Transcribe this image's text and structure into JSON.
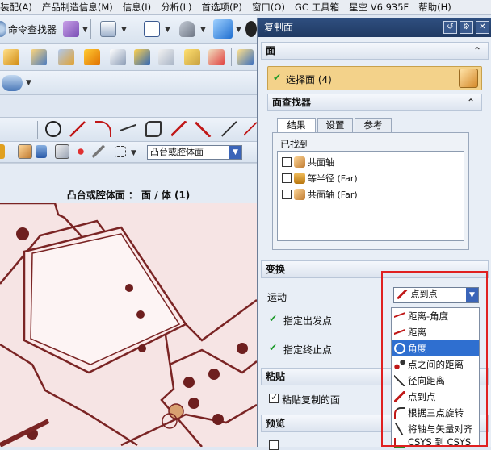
{
  "menu": {
    "items": [
      "装配(A)",
      "产品制造信息(M)",
      "信息(I)",
      "分析(L)",
      "首选项(P)",
      "窗口(O)",
      "GC 工具箱",
      "星空 V6.935F",
      "帮助(H)"
    ],
    "window_buttons": [
      "_",
      "□",
      "×"
    ]
  },
  "toolbar": {
    "command_finder_label": "命令查找器",
    "filter_combo_value": "凸台或腔体面"
  },
  "status": {
    "selection_text": "凸台或腔体面 ： 面 / 体 (1)"
  },
  "dialog": {
    "title": "复制面",
    "sections": {
      "face": {
        "header": "面",
        "select_face_label": "选择面 (4)"
      },
      "face_finder": {
        "header": "面查找器",
        "tabs": [
          "结果",
          "设置",
          "参考"
        ],
        "found_label": "已找到",
        "found_items": [
          {
            "label": "共面轴",
            "checked": false
          },
          {
            "label": "等半径 (Far)",
            "checked": false
          },
          {
            "label": "共面轴 (Far)",
            "checked": false
          }
        ]
      },
      "transform": {
        "header": "变换",
        "motion_label": "运动",
        "motion_value": "点到点",
        "from_point_label": "指定出发点",
        "to_point_label": "指定终止点"
      },
      "paste": {
        "header": "粘贴",
        "paste_copied_label": "粘贴复制的面",
        "paste_copied_checked": true
      },
      "preview": {
        "header": "预览"
      }
    },
    "motion_options": [
      {
        "label": "距离-角度",
        "selected": false
      },
      {
        "label": "距离",
        "selected": false
      },
      {
        "label": "角度",
        "selected": true
      },
      {
        "label": "点之间的距离",
        "selected": false
      },
      {
        "label": "径向距离",
        "selected": false
      },
      {
        "label": "点到点",
        "selected": false
      },
      {
        "label": "根据三点旋转",
        "selected": false
      },
      {
        "label": "将轴与矢量对齐",
        "selected": false
      },
      {
        "label": "CSYS 到 CSYS",
        "selected": false
      }
    ]
  },
  "colors": {
    "highlight_box": "#e02020",
    "selected_row": "#2f6fd0",
    "title_bar": "#203a63",
    "select_face_bg": "#f3d28a",
    "viewport_bg": "#f6e4e4",
    "part_edge": "#7a2424"
  }
}
